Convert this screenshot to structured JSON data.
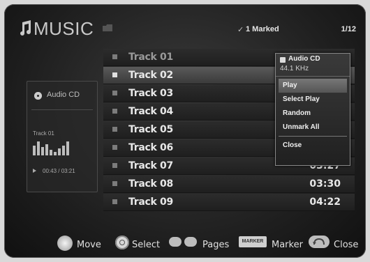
{
  "header": {
    "title": "MUSIC",
    "marked_check": "✓",
    "marked_label": "1 Marked",
    "page_counter": "1/12"
  },
  "left_panel": {
    "disc_label": "Audio CD",
    "now_playing_track": "Track 01",
    "elapsed_total": "00:43 / 03:21"
  },
  "tracks": [
    {
      "name": "Track 01",
      "duration": ""
    },
    {
      "name": "Track 02",
      "duration": ""
    },
    {
      "name": "Track 03",
      "duration": ""
    },
    {
      "name": "Track 04",
      "duration": ""
    },
    {
      "name": "Track 05",
      "duration": ""
    },
    {
      "name": "Track 06",
      "duration": ""
    },
    {
      "name": "Track 07",
      "duration": "03:27"
    },
    {
      "name": "Track 08",
      "duration": "03:30"
    },
    {
      "name": "Track 09",
      "duration": "04:22"
    }
  ],
  "selected_track_index": 1,
  "popup": {
    "title": "Audio CD",
    "sample_rate": "44.1 KHz",
    "items": [
      "Play",
      "Select Play",
      "Random",
      "Unmark All",
      "Close"
    ],
    "active_index": 0
  },
  "footer": {
    "move": "Move",
    "select": "Select",
    "pages": "Pages",
    "marker_badge": "MARKER",
    "marker": "Marker",
    "close": "Close"
  },
  "colors": {
    "background": "#1e1e1e",
    "selected_row": "#5a5a5a",
    "text": "#e8e8e8"
  }
}
